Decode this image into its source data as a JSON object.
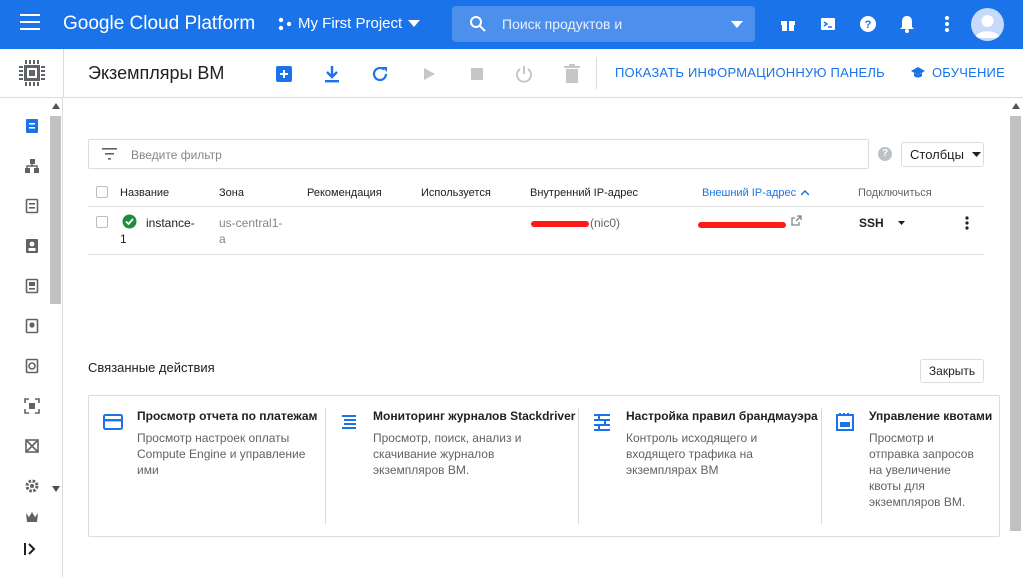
{
  "topbar": {
    "brand": "Google Cloud Platform",
    "project": "My First Project",
    "search_placeholder": "Поиск продуктов и"
  },
  "toolbar": {
    "title": "Экземпляры ВМ",
    "dashboard_link": "ПОКАЗАТЬ ИНФОРМАЦИОННУЮ ПАНЕЛЬ",
    "learn_link": "ОБУЧЕНИЕ"
  },
  "filter": {
    "placeholder": "Введите фильтр",
    "columns_label": "Столбцы"
  },
  "table": {
    "headers": {
      "name": "Название",
      "zone": "Зона",
      "recommendation": "Рекомендация",
      "in_use": "Используется",
      "internal_ip": "Внутренний IP-адрес",
      "external_ip": "Внешний IP-адрес",
      "connect": "Подключиться"
    },
    "rows": [
      {
        "name_line1": "instance-",
        "name_line2": "1",
        "zone_line1": "us-central1-",
        "zone_line2": "a",
        "internal_ip_suffix": "(nic0)",
        "connect": "SSH"
      }
    ]
  },
  "related": {
    "title": "Связанные действия",
    "close_label": "Закрыть",
    "cards": [
      {
        "title": "Просмотр отчета по платежам",
        "desc_lines": [
          "Просмотр настроек оплаты",
          "Compute Engine и управление",
          "ими"
        ]
      },
      {
        "title": "Мониторинг журналов Stackdriver",
        "desc_lines": [
          "Просмотр, поиск, анализ и",
          "скачивание журналов",
          "экземпляров ВМ."
        ]
      },
      {
        "title": "Настройка правил брандмауэра",
        "desc_lines": [
          "Контроль исходящего и",
          "входящего трафика на",
          "экземплярах ВМ"
        ]
      },
      {
        "title": "Управление квотами",
        "desc_lines": [
          "Просмотр и",
          "отправка запросов",
          "на увеличение",
          "квоты для",
          "экземпляров ВМ."
        ]
      }
    ]
  },
  "colors": {
    "brand_blue": "#1a73e8",
    "status_green": "#1e8e3e",
    "redaction_red": "#ff1a1a"
  }
}
